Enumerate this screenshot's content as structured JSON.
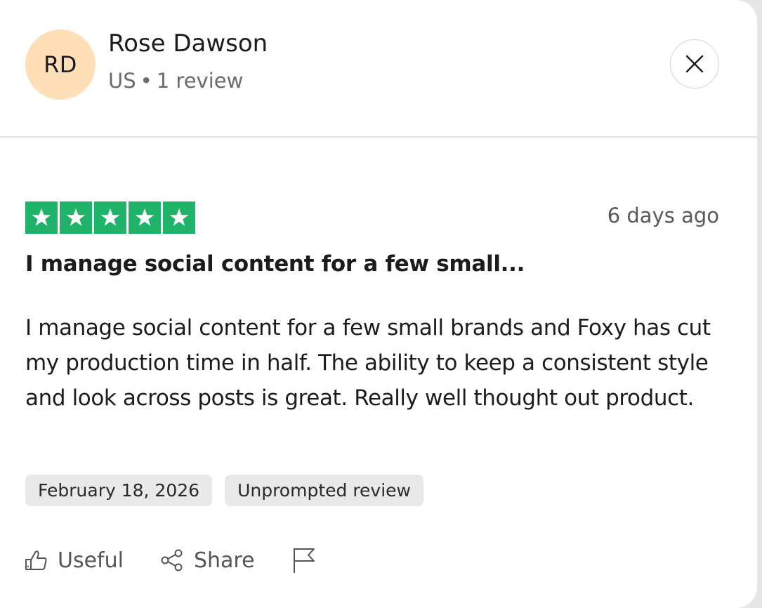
{
  "reviewer": {
    "initials": "RD",
    "name": "Rose Dawson",
    "country": "US",
    "separator": "•",
    "review_count": "1 review",
    "avatar_color": "#ffdfb8"
  },
  "close_icon": "close-icon",
  "review": {
    "rating": 5,
    "rating_max": 5,
    "star_color": "#20b46a",
    "relative_date": "6 days ago",
    "title": "I manage social content for a few small...",
    "body": "I manage social content for a few small brands and Foxy has cut my production time in half. The ability to keep a consistent style and look across posts is great. Really well thought out product.",
    "tags": [
      "February 18, 2026",
      "Unprompted review"
    ]
  },
  "actions": {
    "useful_label": "Useful",
    "share_label": "Share",
    "useful_icon": "thumbs-up-icon",
    "share_icon": "share-icon",
    "report_icon": "flag-icon"
  }
}
